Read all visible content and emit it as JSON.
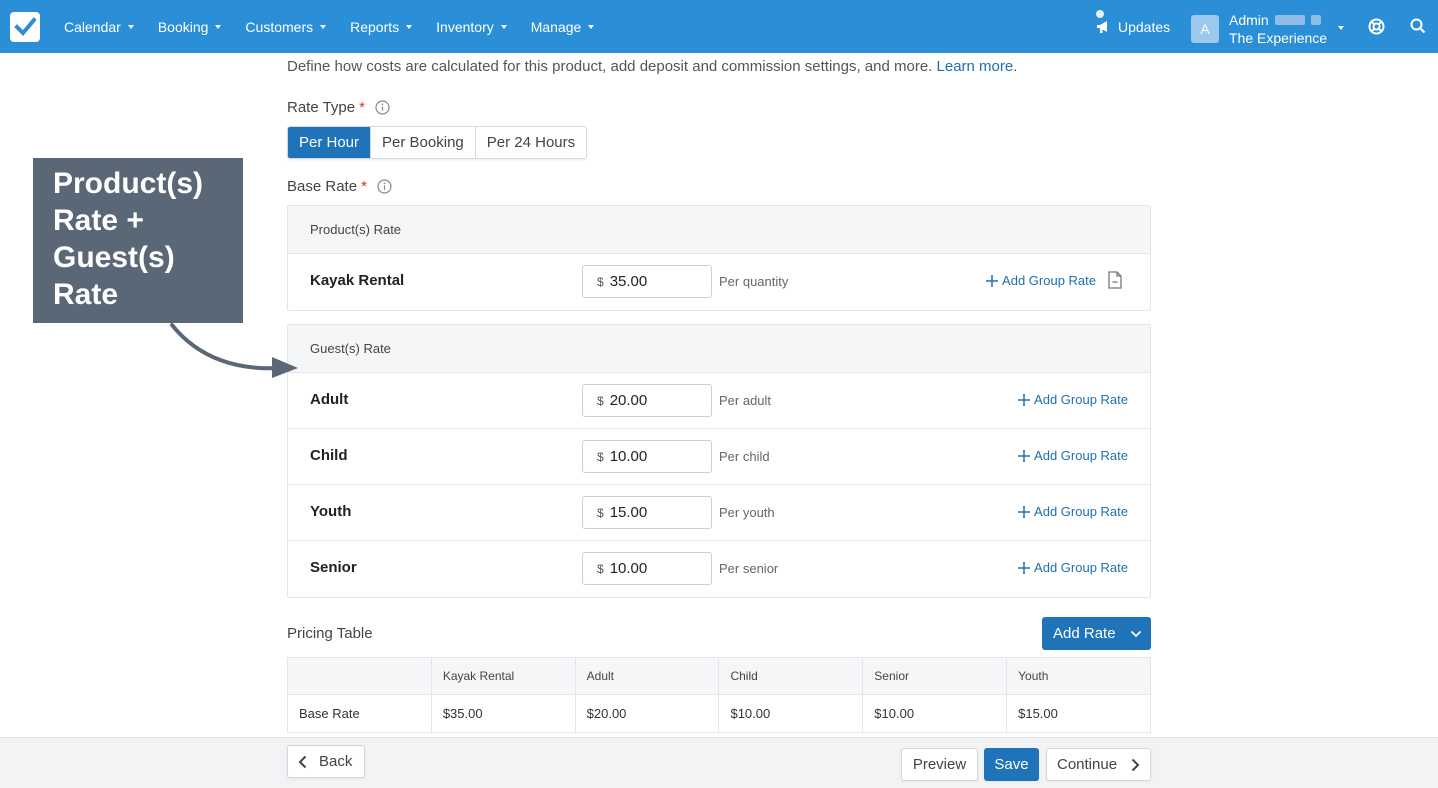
{
  "nav": {
    "items": [
      "Calendar",
      "Booking",
      "Customers",
      "Reports",
      "Inventory",
      "Manage"
    ],
    "updates": "Updates",
    "user_initial": "A",
    "user_name": "Admin",
    "company": "The Experience"
  },
  "intro": {
    "text": "Define how costs are calculated for this product, add deposit and commission settings, and more.",
    "link": "Learn more",
    "period": "."
  },
  "rate_type": {
    "label": "Rate Type",
    "required": "*",
    "options": [
      "Per Hour",
      "Per Booking",
      "Per 24 Hours"
    ],
    "selected": "Per Hour"
  },
  "base_rate": {
    "label": "Base Rate",
    "required": "*",
    "product_section": {
      "header": "Product(s) Rate",
      "rows": [
        {
          "name": "Kayak Rental",
          "currency": "$",
          "value": "35.00",
          "per": "Per quantity",
          "action": "Add Group Rate"
        }
      ]
    },
    "guest_section": {
      "header": "Guest(s) Rate",
      "rows": [
        {
          "name": "Adult",
          "currency": "$",
          "value": "20.00",
          "per": "Per adult",
          "action": "Add Group Rate"
        },
        {
          "name": "Child",
          "currency": "$",
          "value": "10.00",
          "per": "Per child",
          "action": "Add Group Rate"
        },
        {
          "name": "Youth",
          "currency": "$",
          "value": "15.00",
          "per": "Per youth",
          "action": "Add Group Rate"
        },
        {
          "name": "Senior",
          "currency": "$",
          "value": "10.00",
          "per": "Per senior",
          "action": "Add Group Rate"
        }
      ]
    }
  },
  "annotation": {
    "lines": [
      "Product(s)",
      "Rate +",
      "Guest(s)",
      "Rate"
    ]
  },
  "pricing_table": {
    "label": "Pricing Table",
    "add_button": "Add Rate",
    "columns": [
      "",
      "Kayak Rental",
      "Adult",
      "Child",
      "Senior",
      "Youth"
    ],
    "rows": [
      [
        "Base Rate",
        "$35.00",
        "$20.00",
        "$10.00",
        "$10.00",
        "$15.00"
      ]
    ]
  },
  "footer": {
    "back": "Back",
    "preview": "Preview",
    "save": "Save",
    "continue": "Continue"
  },
  "colors": {
    "topbar": "#2b8fd8",
    "primary": "#1f73b8",
    "link": "#1f6fb2",
    "required": "#d9342b",
    "annotation": "#5a6777"
  }
}
